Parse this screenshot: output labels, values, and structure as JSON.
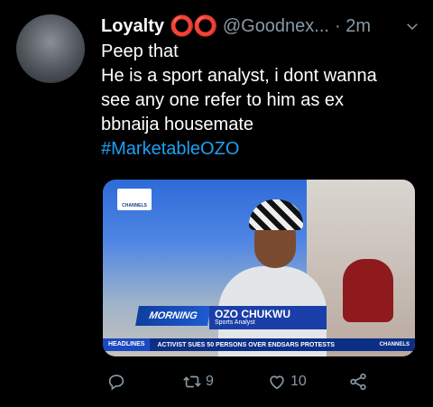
{
  "tweet": {
    "display_name": "Loyalty",
    "emoji": "⭕⭕",
    "handle": "@Goodnex...",
    "separator": "·",
    "time": "2m",
    "lines": [
      "Peep that",
      "He is a sport analyst, i dont wanna",
      "see any one refer to him as ex",
      "bbnaija housemate"
    ],
    "hashtag": "#MarketableOZO"
  },
  "media": {
    "channel_logo": "CHANNELS",
    "show_logo": "MORNING",
    "name": "OZO CHUKWU",
    "title": "Sports Analyst",
    "ticker_label": "HEADLINES",
    "ticker_text": "ACTIVIST SUES 50 PERSONS OVER ENDSARS PROTESTS",
    "ticker_brand": "CHANNELS"
  },
  "actions": {
    "reply_icon": "reply-icon",
    "retweet_icon": "retweet-icon",
    "retweet_count": "9",
    "like_icon": "heart-icon",
    "like_count": "10",
    "share_icon": "share-icon"
  },
  "colors": {
    "background": "#000000",
    "text": "#ffffff",
    "muted": "#8899a6",
    "link": "#1da1f2",
    "emoji_red": "#e0262b"
  }
}
